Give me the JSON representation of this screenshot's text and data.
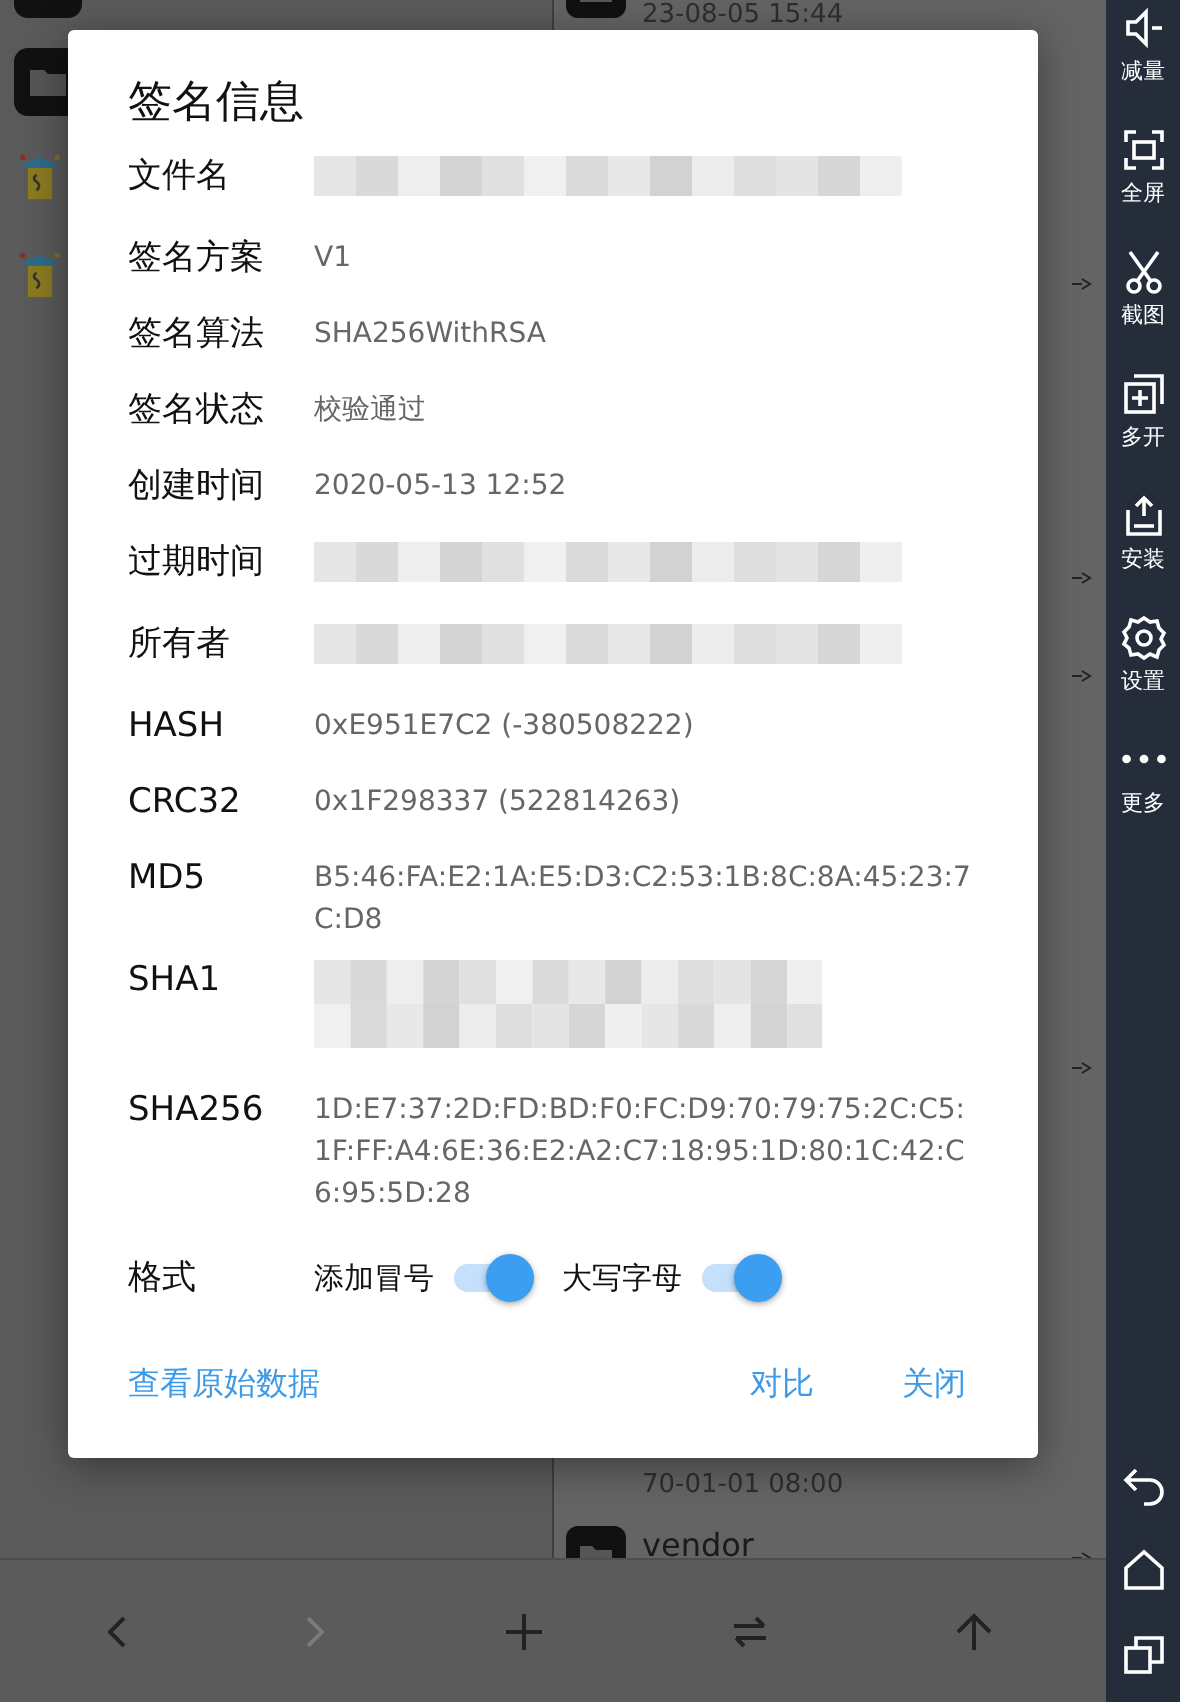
{
  "left_panel": {
    "rows": [
      {
        "kind": "folder"
      },
      {
        "kind": "folder"
      },
      {
        "kind": "apk"
      },
      {
        "kind": "apk"
      }
    ]
  },
  "right_panel": {
    "rows": [
      {
        "kind": "folder",
        "date": "23-08-05 15:44",
        "link": false
      },
      {
        "link": false
      },
      {
        "link": false
      },
      {
        "link": true
      },
      {
        "link": false
      },
      {
        "link": false
      },
      {
        "link": true
      },
      {
        "link": true
      },
      {
        "link": false
      },
      {
        "link": false
      },
      {
        "link": false
      },
      {
        "link": true
      },
      {
        "link": false
      },
      {
        "link": false
      },
      {
        "link": false
      },
      {
        "date": "70-01-01 08:00",
        "link": false
      },
      {
        "kind": "folder",
        "name": "vendor",
        "link": true
      }
    ]
  },
  "toolbar": [
    {
      "kind": "back",
      "disabled": false
    },
    {
      "kind": "forward",
      "disabled": true
    },
    {
      "kind": "add",
      "disabled": false
    },
    {
      "kind": "swap",
      "disabled": false
    },
    {
      "kind": "up",
      "disabled": false
    }
  ],
  "sidebar": {
    "tools": [
      {
        "kind": "volume-down",
        "label": "减量"
      },
      {
        "kind": "fullscreen",
        "label": "全屏"
      },
      {
        "kind": "screenshot",
        "label": "截图"
      },
      {
        "kind": "multi",
        "label": "多开"
      },
      {
        "kind": "install",
        "label": "安装"
      },
      {
        "kind": "settings",
        "label": "设置"
      },
      {
        "kind": "more",
        "label": "更多"
      }
    ],
    "nav": [
      {
        "kind": "back"
      },
      {
        "kind": "home"
      },
      {
        "kind": "recents"
      }
    ]
  },
  "dialog": {
    "title": "签名信息",
    "rows": [
      {
        "label": "文件名",
        "kind": "redacted"
      },
      {
        "label": "签名方案",
        "kind": "text",
        "value": "V1"
      },
      {
        "label": "签名算法",
        "kind": "text",
        "value": "SHA256WithRSA"
      },
      {
        "label": "签名状态",
        "kind": "text",
        "value": "校验通过"
      },
      {
        "label": "创建时间",
        "kind": "text",
        "value": "2020-05-13 12:52"
      },
      {
        "label": "过期时间",
        "kind": "redacted"
      },
      {
        "label": "所有者",
        "kind": "redacted"
      },
      {
        "label": "HASH",
        "kind": "text",
        "value": "0xE951E7C2 (-380508222)"
      },
      {
        "label": "CRC32",
        "kind": "text",
        "value": "0x1F298337 (522814263)"
      },
      {
        "label": "MD5",
        "kind": "text",
        "value": "B5:46:FA:E2:1A:E5:D3:C2:53:1B:8C:8A:45:23:7C:D8"
      },
      {
        "label": "SHA1",
        "kind": "redacted-long"
      },
      {
        "label": "SHA256",
        "kind": "text",
        "value": "1D:E7:37:2D:FD:BD:F0:FC:D9:70:79:75:2C:C5:1F:FF:A4:6E:36:E2:A2:C7:18:95:1D:80:1C:42:C6:95:5D:28"
      }
    ],
    "format": {
      "label": "格式",
      "options": [
        {
          "label": "添加冒号",
          "on": true
        },
        {
          "label": "大写字母",
          "on": true
        }
      ]
    },
    "actions": {
      "left": "查看原始数据",
      "right": [
        "对比",
        "关闭"
      ]
    }
  }
}
